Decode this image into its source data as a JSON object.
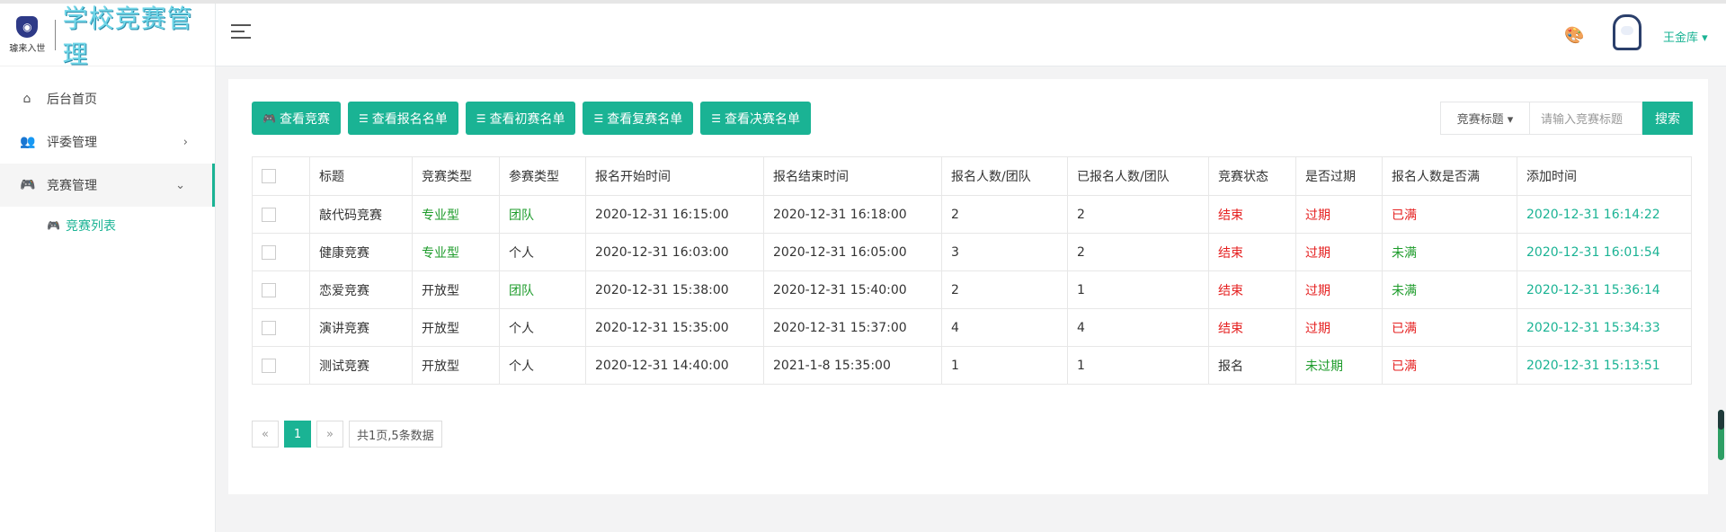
{
  "brand": {
    "small": "璩来入世",
    "title": "学校竞赛管理"
  },
  "sidebar": {
    "items": [
      {
        "label": "后台首页",
        "icon": "home-icon"
      },
      {
        "label": "评委管理",
        "icon": "users-icon"
      },
      {
        "label": "竞赛管理",
        "icon": "gamepad-icon"
      }
    ],
    "sub": {
      "label": "竞赛列表",
      "icon": "gamepad-icon"
    }
  },
  "header": {
    "user": "王金库 ▾"
  },
  "toolbar": {
    "buttons": [
      "查看竞赛",
      "查看报名名单",
      "查看初赛名单",
      "查看复赛名单",
      "查看决赛名单"
    ],
    "search_select": "竞赛标题 ▾",
    "search_placeholder": "请输入竞赛标题",
    "search_label": "搜索"
  },
  "table": {
    "columns": [
      "标题",
      "竞赛类型",
      "参赛类型",
      "报名开始时间",
      "报名结束时间",
      "报名人数/团队",
      "已报名人数/团队",
      "竞赛状态",
      "是否过期",
      "报名人数是否满",
      "添加时间"
    ],
    "rows": [
      [
        "敲代码竞赛",
        "专业型",
        "团队",
        "2020-12-31 16:15:00",
        "2020-12-31 16:18:00",
        "2",
        "2",
        "结束",
        "过期",
        "已满",
        "2020-12-31 16:14:22"
      ],
      [
        "健康竞赛",
        "专业型",
        "个人",
        "2020-12-31 16:03:00",
        "2020-12-31 16:05:00",
        "3",
        "2",
        "结束",
        "过期",
        "未满",
        "2020-12-31 16:01:54"
      ],
      [
        "恋爱竞赛",
        "开放型",
        "团队",
        "2020-12-31 15:38:00",
        "2020-12-31 15:40:00",
        "2",
        "1",
        "结束",
        "过期",
        "未满",
        "2020-12-31 15:36:14"
      ],
      [
        "演讲竞赛",
        "开放型",
        "个人",
        "2020-12-31 15:35:00",
        "2020-12-31 15:37:00",
        "4",
        "4",
        "结束",
        "过期",
        "已满",
        "2020-12-31 15:34:33"
      ],
      [
        "测试竞赛",
        "开放型",
        "个人",
        "2020-12-31 14:40:00",
        "2021-1-8 15:35:00",
        "1",
        "1",
        "报名",
        "未过期",
        "已满",
        "2020-12-31 15:13:51"
      ]
    ],
    "row_colors": [
      [
        "",
        "green",
        "green",
        "",
        "",
        "",
        "",
        "red",
        "red",
        "red",
        "teal"
      ],
      [
        "",
        "green",
        "",
        "",
        "",
        "",
        "",
        "red",
        "red",
        "green",
        "teal"
      ],
      [
        "",
        "",
        "green",
        "",
        "",
        "",
        "",
        "red",
        "red",
        "green",
        "teal"
      ],
      [
        "",
        "",
        "",
        "",
        "",
        "",
        "",
        "red",
        "red",
        "red",
        "teal"
      ],
      [
        "",
        "",
        "",
        "",
        "",
        "",
        "",
        "",
        "green",
        "red",
        "teal"
      ]
    ]
  },
  "pager": {
    "prev": "«",
    "current": "1",
    "next": "»",
    "info": "共1页,5条数据"
  },
  "colors": {
    "accent": "#1ab394",
    "green": "#1c9b2a",
    "red": "#e52020"
  }
}
